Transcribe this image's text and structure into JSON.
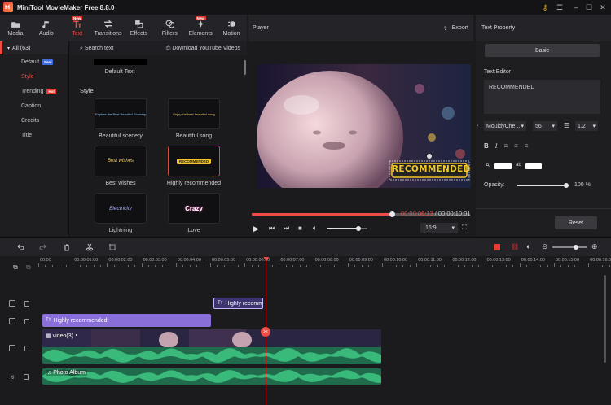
{
  "app": {
    "title": "MiniTool MovieMaker Free 8.8.0"
  },
  "toolbar": [
    {
      "label": "Media",
      "icon": "folder-icon"
    },
    {
      "label": "Audio",
      "icon": "music-note-icon"
    },
    {
      "label": "Text",
      "icon": "text-icon",
      "badge": "New",
      "active": true
    },
    {
      "label": "Transitions",
      "icon": "transition-arrows-icon"
    },
    {
      "label": "Effects",
      "icon": "effects-icon"
    },
    {
      "label": "Filters",
      "icon": "filters-icon"
    },
    {
      "label": "Elements",
      "icon": "sparkle-icon",
      "badge": "New"
    },
    {
      "label": "Motion",
      "icon": "motion-icon"
    }
  ],
  "leftnav": {
    "header": "All (63)",
    "items": [
      {
        "label": "Default",
        "badge": "New",
        "badge_color": "#3b6fe0"
      },
      {
        "label": "Style",
        "selected": true
      },
      {
        "label": "Trending",
        "badge": "Hot",
        "badge_color": "#e53a36"
      },
      {
        "label": "Caption"
      },
      {
        "label": "Credits"
      },
      {
        "label": "Title"
      }
    ]
  },
  "content": {
    "search_label": "Search text",
    "download_label": "Download YouTube Videos",
    "default_text_label": "Default Text",
    "section_title": "Style",
    "cards": [
      {
        "label": "Beautiful scenery",
        "preview": "Explore the Best Beautiful Scenery"
      },
      {
        "label": "Beautiful song",
        "preview": "Enjoy the best beautiful song"
      },
      {
        "label": "Best wishes",
        "preview": "Best wishes"
      },
      {
        "label": "Highly recommended",
        "preview": "RECOMMENDED",
        "selected": true
      },
      {
        "label": "Lightning",
        "preview": "Electricity"
      },
      {
        "label": "Love",
        "preview": "Crazy"
      }
    ]
  },
  "player": {
    "title": "Player",
    "export_label": "Export",
    "overlay_text": "RECOMMENDED",
    "current_time": "00:00:06:13",
    "separator": " / ",
    "total_time": "00:00:10:01",
    "aspect": "16:9",
    "progress": 0.64,
    "volume": 0.78
  },
  "textprop": {
    "title": "Text Property",
    "basic_tab": "Basic",
    "editor_label": "Text Editor",
    "editor_value": "RECOMMENDED",
    "font": "MouldyChe...",
    "size": "56",
    "line_spacing": "1.2",
    "opacity_label": "Opacity:",
    "opacity_value": "100 %",
    "opacity": 1.0,
    "reset_label": "Reset"
  },
  "timeline": {
    "ticks": [
      "00:00",
      "00:00:01:00",
      "00:00:02:00",
      "00:00:03:00",
      "00:00:04:00",
      "00:00:05:00",
      "00:00:06:00",
      "00:00:07:00",
      "00:00:08:00",
      "00:00:09:00",
      "00:00:10:00",
      "00:00:11:00",
      "00:00:12:00",
      "00:00:13:00",
      "00:00:14:00",
      "00:00:15:00",
      "00:00:16:00"
    ],
    "text_clip_small": "Highly recomm",
    "text_clip": "Highly recommended",
    "video_clip": "video(3)",
    "audio_clip": "Photo Album",
    "playhead_time": 6.5
  },
  "colors": {
    "accent": "#ee4c44",
    "text_clip": "#8b6fd9",
    "audio": "#2ea86e",
    "video_wave": "#2ea86e"
  }
}
